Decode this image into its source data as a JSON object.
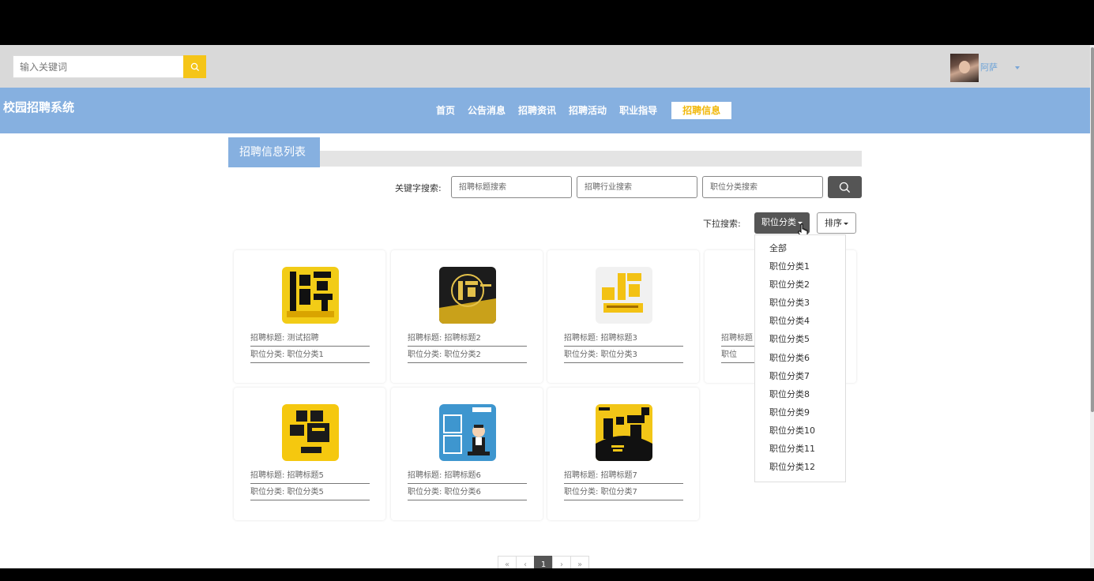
{
  "search": {
    "placeholder": "输入关键词"
  },
  "user": {
    "name": "阿萨"
  },
  "brand": "校园招聘系统",
  "nav": {
    "items": [
      "首页",
      "公告消息",
      "招聘资讯",
      "招聘活动",
      "职业指导"
    ],
    "active": "招聘信息"
  },
  "panel": {
    "title": "招聘信息列表"
  },
  "keyword": {
    "label": "关键字搜索:",
    "title_placeholder": "招聘标题搜索",
    "industry_placeholder": "招聘行业搜索",
    "category_placeholder": "职位分类搜索"
  },
  "dropdown": {
    "label": "下拉搜索:",
    "category_button": "职位分类",
    "sort_button": "排序",
    "options": [
      "全部",
      "职位分类1",
      "职位分类2",
      "职位分类3",
      "职位分类4",
      "职位分类5",
      "职位分类6",
      "职位分类7",
      "职位分类8",
      "职位分类9",
      "职位分类10",
      "职位分类11",
      "职位分类12"
    ]
  },
  "cards": [
    {
      "title_line": "招聘标题: 测试招聘",
      "category_line": "职位分类: 职位分类1",
      "image": "yellow-black-pin-poster"
    },
    {
      "title_line": "招聘标题: 招聘标题2",
      "category_line": "职位分类: 职位分类2",
      "image": "dark-gold-pin-poster"
    },
    {
      "title_line": "招聘标题: 招聘标题3",
      "category_line": "职位分类: 职位分类3",
      "image": "yellow-pin-badge"
    },
    {
      "title_line": "招聘标题",
      "category_line": "职位",
      "image": "hidden"
    },
    {
      "title_line": "招聘标题: 招聘标题5",
      "category_line": "职位分类: 职位分类5",
      "image": "yellow-women-need-you"
    },
    {
      "title_line": "招聘标题: 招聘标题6",
      "category_line": "职位分类: 职位分类6",
      "image": "blue-part-time-poster"
    },
    {
      "title_line": "招聘标题: 招聘标题7",
      "category_line": "职位分类: 职位分类7",
      "image": "yellow-join-us-poster"
    }
  ],
  "pagination": {
    "first": "«",
    "prev": "‹",
    "current": "1",
    "next": "›",
    "last": "»"
  },
  "colors": {
    "nav_bg": "#86b0e0",
    "accent_yellow": "#f5c518",
    "active_text": "#f1b80b",
    "button_dark": "#555555"
  }
}
